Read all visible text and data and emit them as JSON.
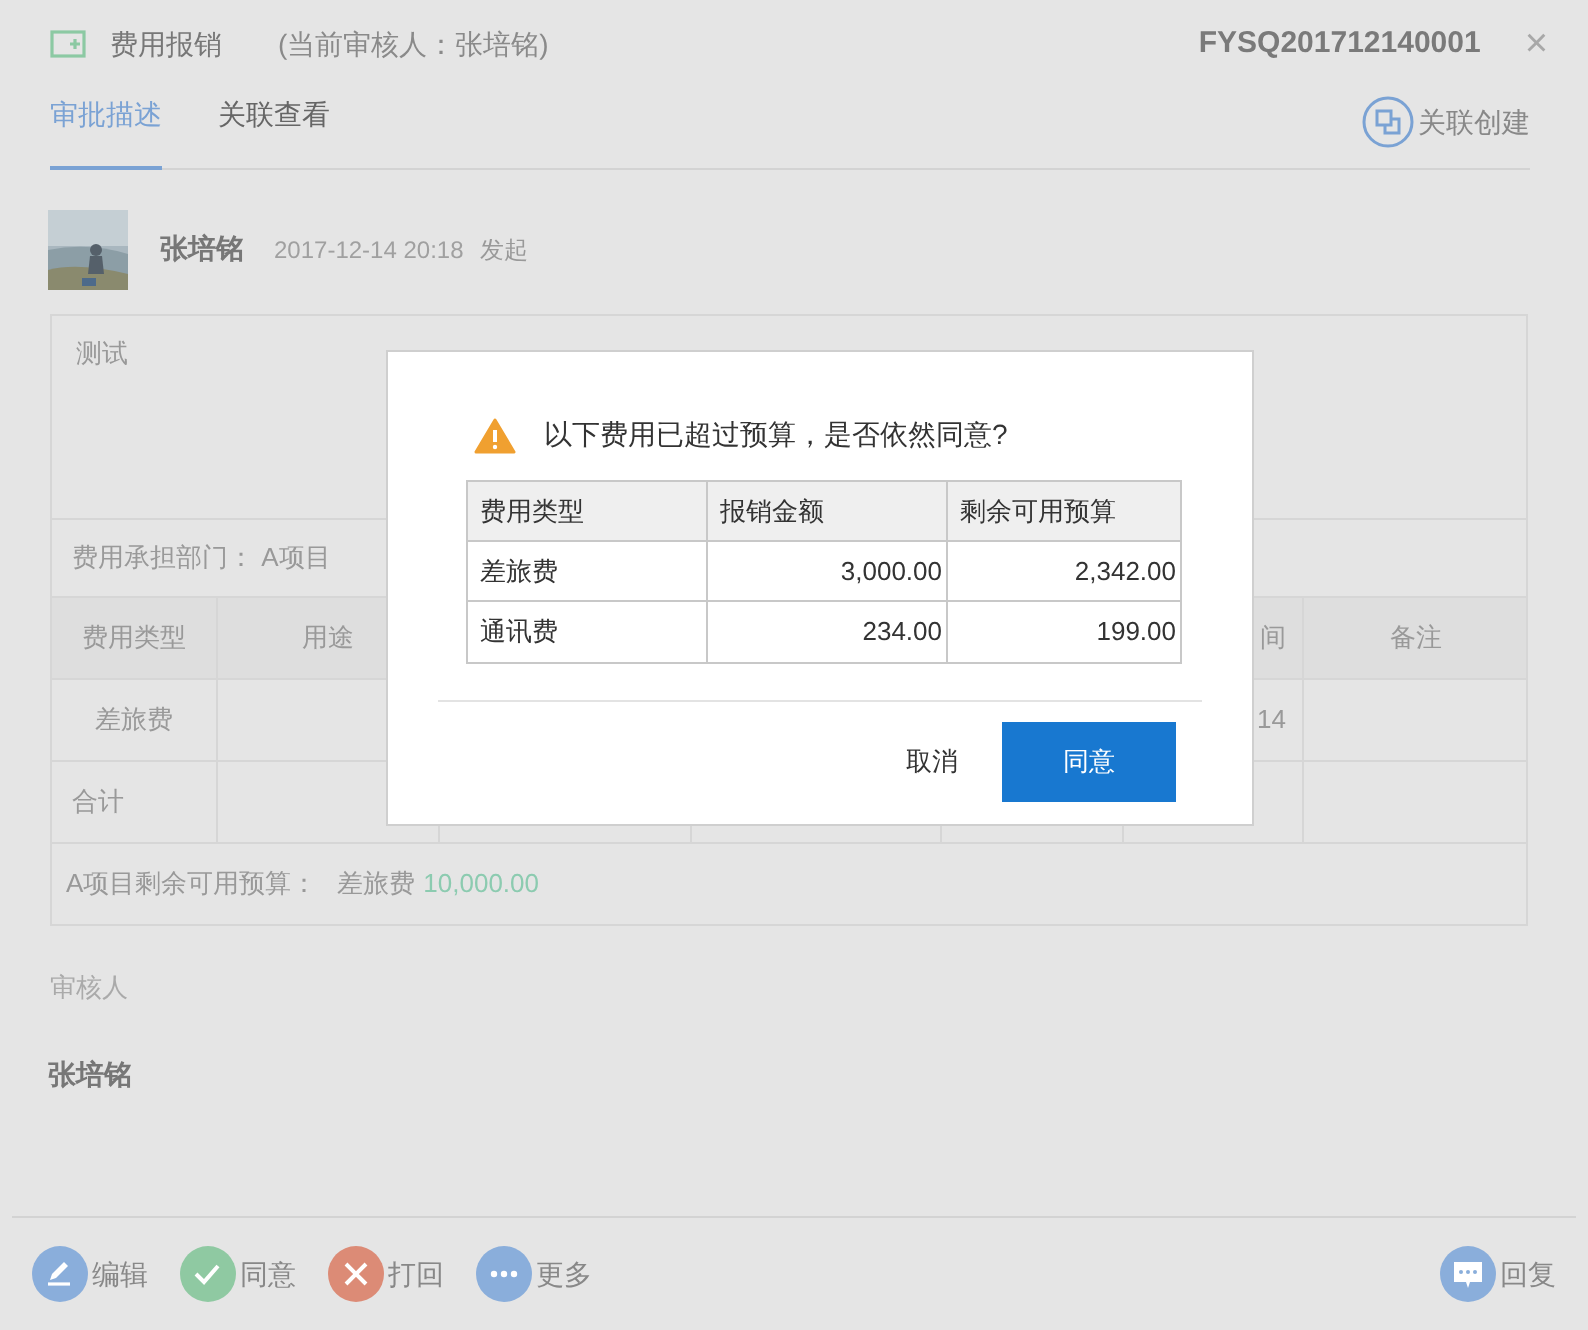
{
  "header": {
    "title": "费用报销",
    "subtitle": "(当前审核人：张培铭)",
    "doc_number": "FYSQ201712140001",
    "close": "×"
  },
  "tabs": [
    {
      "label": "审批描述",
      "selected": true
    },
    {
      "label": "关联查看",
      "selected": false
    }
  ],
  "related_create": "关联创建",
  "submitter": {
    "name": "张培铭",
    "date": "2017-12-14 20:18",
    "action": "发起"
  },
  "content": {
    "description": "测试",
    "department_label": "费用承担部门：",
    "department": "A项目",
    "expense_table": {
      "header": {
        "column_1": "费用类型",
        "column_2": "用途",
        "column_6": "间",
        "column_7": "备注"
      },
      "rows": [
        {
          "column_1": "差旅费",
          "column_6": "14"
        },
        {
          "column_1": "合计"
        }
      ]
    },
    "budget_label": "A项目剩余可用预算：",
    "budget_type": "差旅费",
    "budget_amount": "10,000.00"
  },
  "reviewer": {
    "label": "审核人",
    "name": "张培铭"
  },
  "actions": [
    {
      "kind": "edit",
      "label": "编辑"
    },
    {
      "kind": "approve",
      "label": "同意"
    },
    {
      "kind": "reject",
      "label": "打回"
    },
    {
      "kind": "more",
      "label": "更多"
    }
  ],
  "reply": "回复",
  "dialog": {
    "message": "以下费用已超过预算，是否依然同意?",
    "columns": [
      "费用类型",
      "报销金额",
      "剩余可用预算"
    ],
    "rows": [
      [
        "差旅费",
        "3,000.00",
        "2,342.00"
      ],
      [
        "通讯费",
        "234.00",
        "199.00"
      ]
    ],
    "cancel": "取消",
    "confirm": "同意"
  }
}
